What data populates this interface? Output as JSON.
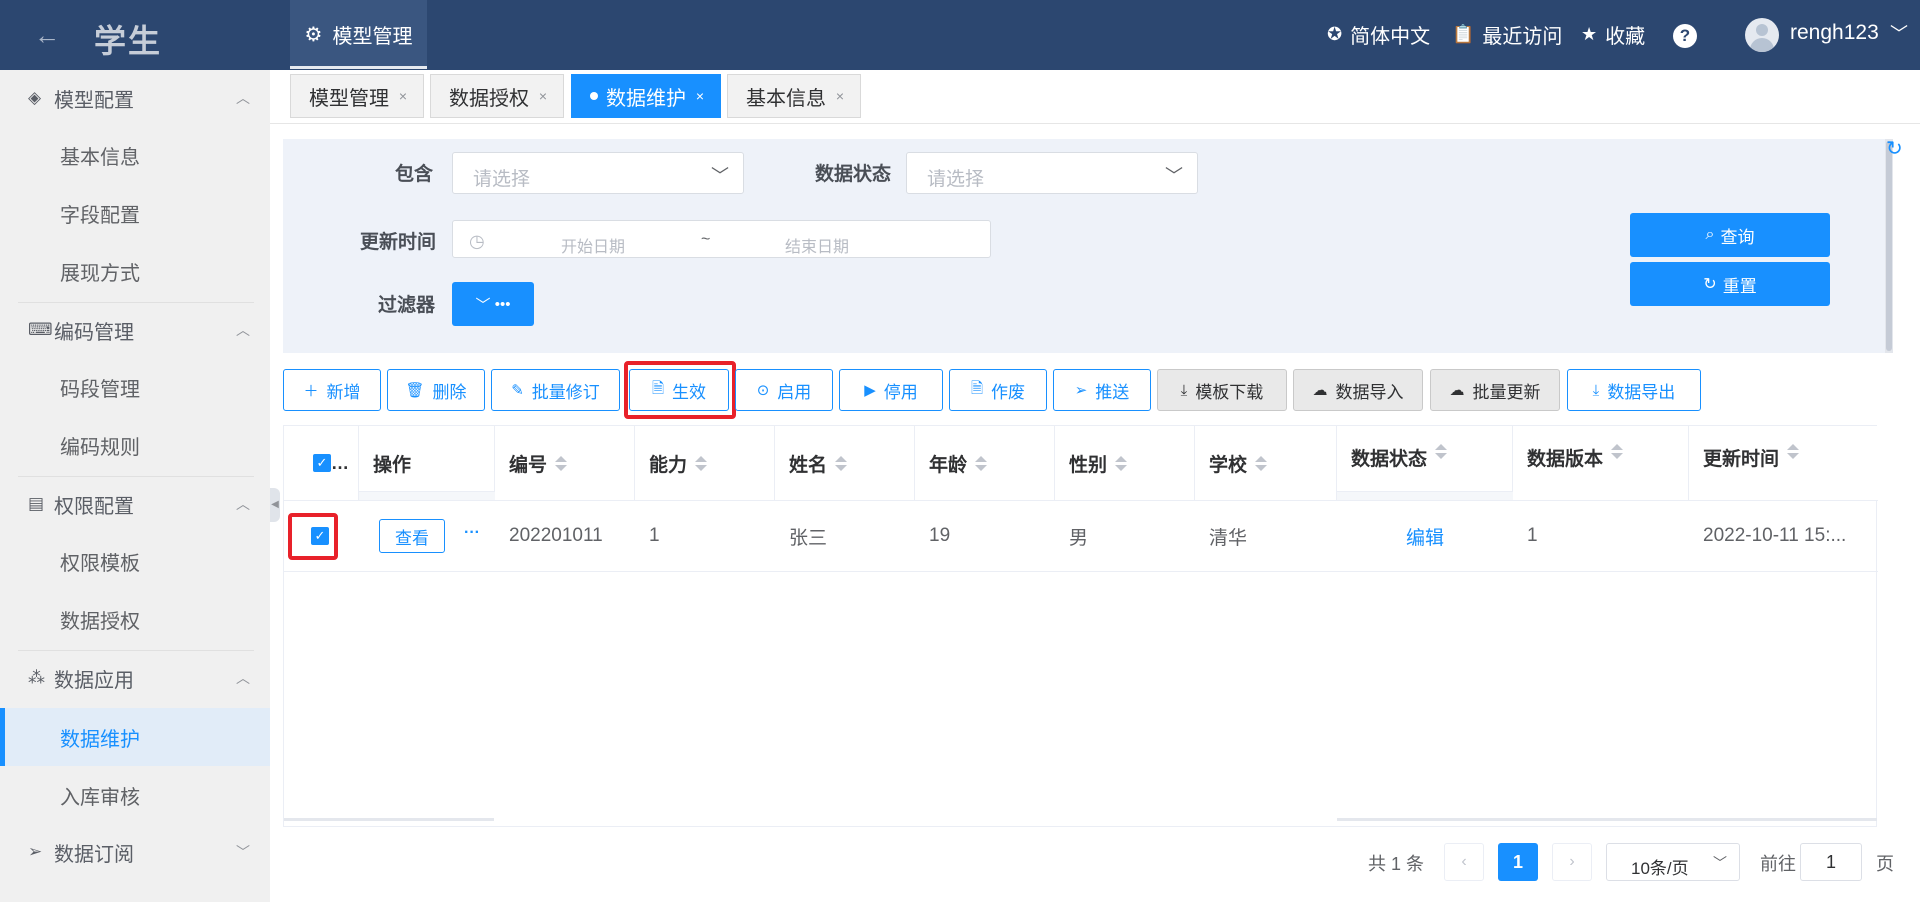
{
  "header": {
    "app_title": "学生",
    "active_module": "模型管理",
    "language": "简体中文",
    "recent": "最近访问",
    "favorites": "收藏",
    "username": "rengh123"
  },
  "sidebar": {
    "groups": [
      {
        "label": "模型配置",
        "items": [
          "基本信息",
          "字段配置",
          "展现方式"
        ]
      },
      {
        "label": "编码管理",
        "items": [
          "码段管理",
          "编码规则"
        ]
      },
      {
        "label": "权限配置",
        "items": [
          "权限模板",
          "数据授权"
        ]
      },
      {
        "label": "数据应用",
        "items": [
          "数据维护",
          "入库审核"
        ]
      },
      {
        "label": "数据订阅",
        "items": []
      }
    ],
    "active_item": "数据维护"
  },
  "tabs": [
    {
      "label": "模型管理"
    },
    {
      "label": "数据授权"
    },
    {
      "label": "数据维护"
    },
    {
      "label": "基本信息"
    }
  ],
  "filter": {
    "include_label": "包含",
    "include_placeholder": "请选择",
    "status_label": "数据状态",
    "status_placeholder": "请选择",
    "update_time_label": "更新时间",
    "start_date_placeholder": "开始日期",
    "date_separator": "~",
    "end_date_placeholder": "结束日期",
    "filter_label": "过滤器",
    "query_button": "查询",
    "reset_button": "重置"
  },
  "toolbar": {
    "add": "新增",
    "delete": "删除",
    "batch_edit": "批量修订",
    "effective": "生效",
    "enable": "启用",
    "disable": "停用",
    "void": "作废",
    "push": "推送",
    "template_download": "模板下载",
    "import": "数据导入",
    "batch_update": "批量更新",
    "export": "数据导出"
  },
  "table": {
    "select_all_suffix": "…",
    "columns": [
      "操作",
      "编号",
      "能力",
      "姓名",
      "年龄",
      "性别",
      "学校",
      "数据状态",
      "数据版本",
      "更新时间"
    ],
    "rows": [
      {
        "checked": true,
        "view": "查看",
        "more": "···",
        "id": "202201011",
        "ability": "1",
        "name": "张三",
        "age": "19",
        "gender": "男",
        "school": "清华",
        "status": "编辑",
        "version": "1",
        "updated": "2022-10-11 15:..."
      }
    ]
  },
  "pagination": {
    "total_text": "共 1 条",
    "current_page": "1",
    "page_size": "10条/页",
    "goto_prefix": "前往",
    "goto_value": "1",
    "goto_suffix": "页"
  },
  "colors": {
    "header_bg": "#2c4770",
    "primary": "#1890ff",
    "highlight_box": "#e8212a",
    "sidebar_bg": "#f0f0f0",
    "filter_bg": "#eef2f9"
  }
}
